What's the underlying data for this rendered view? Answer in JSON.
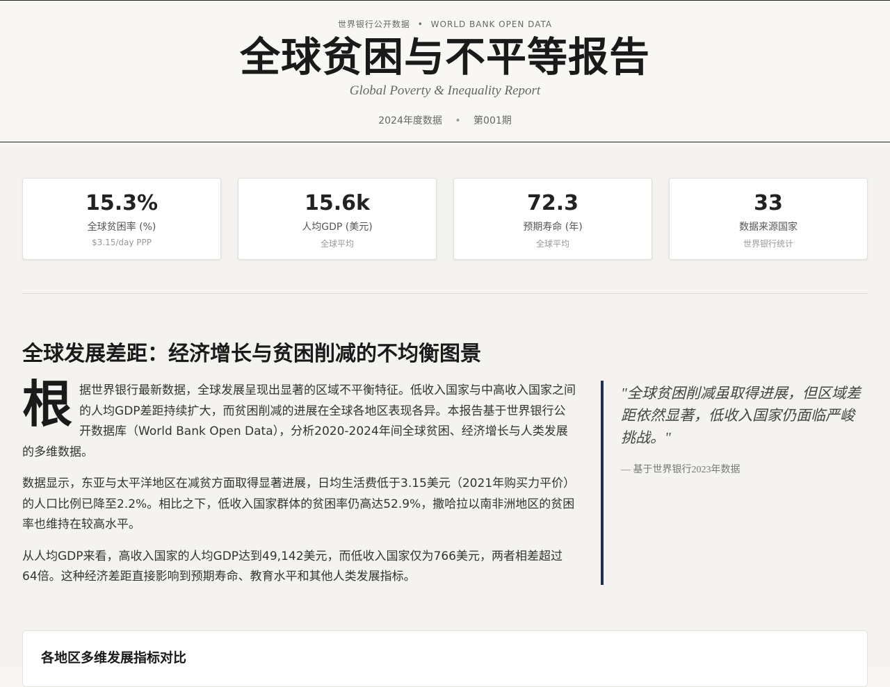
{
  "masthead": {
    "kicker_cn": "世界银行公开数据",
    "kicker_sep": "•",
    "kicker_en": "WORLD BANK OPEN DATA",
    "title": "全球贫困与不平等报告",
    "subtitle": "Global Poverty & Inequality Report",
    "edition": "2024年度数据",
    "meta_sep": "•",
    "issue": "第001期"
  },
  "stats": [
    {
      "value": "15.3%",
      "label": "全球贫困率 (%)",
      "note": "$3.15/day PPP"
    },
    {
      "value": "15.6k",
      "label": "人均GDP (美元)",
      "note": "全球平均"
    },
    {
      "value": "72.3",
      "label": "预期寿命 (年)",
      "note": "全球平均"
    },
    {
      "value": "33",
      "label": "数据来源国家",
      "note": "世界银行统计"
    }
  ],
  "article": {
    "title": "全球发展差距：经济增长与贫困削减的不均衡图景",
    "dropcap": "根",
    "p1_rest": "据世界银行最新数据，全球发展呈现出显著的区域不平衡特征。低收入国家与中高收入国家之间的人均GDP差距持续扩大，而贫困削减的进展在全球各地区表现各异。本报告基于世界银行公开数据库（World Bank Open Data），分析2020-2024年间全球贫困、经济增长与人类发展的多维数据。",
    "p2": "数据显示，东亚与太平洋地区在减贫方面取得显著进展，日均生活费低于3.15美元（2021年购买力平价）的人口比例已降至2.2%。相比之下，低收入国家群体的贫困率仍高达52.9%，撒哈拉以南非洲地区的贫困率也维持在较高水平。",
    "p3": "从人均GDP来看，高收入国家的人均GDP达到49,142美元，而低收入国家仅为766美元，两者相差超过64倍。这种经济差距直接影响到预期寿命、教育水平和其他人类发展指标。"
  },
  "pullquote": {
    "quote": "\"全球贫困削减虽取得进展，但区域差距依然显著，低收入国家仍面临严峻挑战。\"",
    "cite": "— 基于世界银行2023年数据"
  },
  "panel": {
    "title": "各地区多维发展指标对比"
  }
}
